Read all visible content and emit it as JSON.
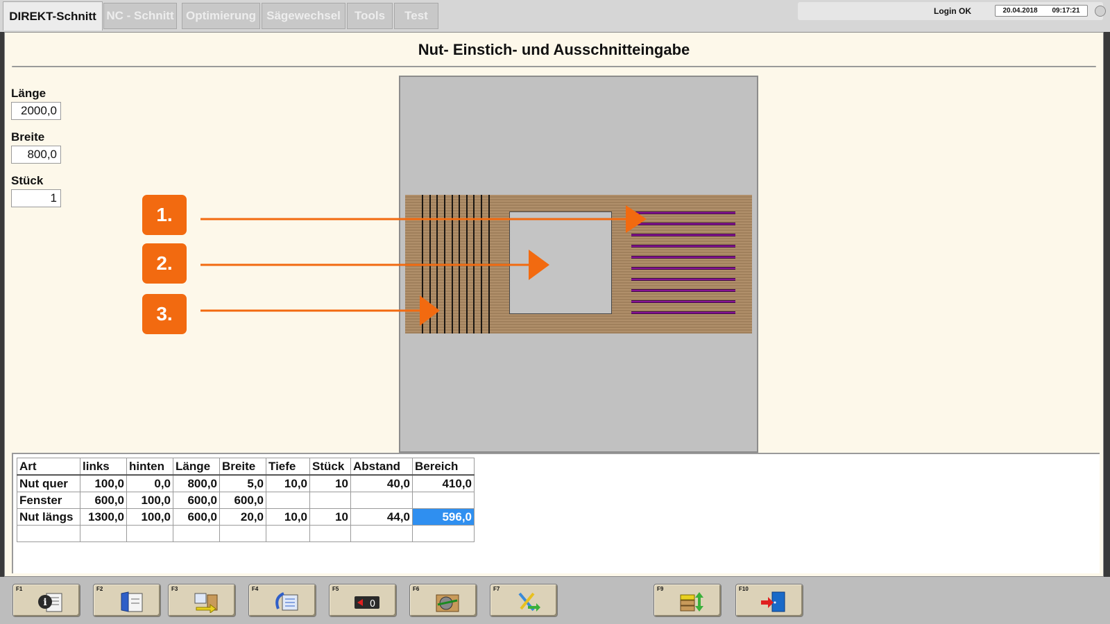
{
  "tabs": [
    {
      "label": "DIREKT-Schnitt",
      "active": true
    },
    {
      "label": "NC - Schnitt",
      "active": false
    },
    {
      "label": "Optimierung",
      "active": false
    },
    {
      "label": "Sägewechsel",
      "active": false
    },
    {
      "label": "Tools",
      "active": false
    },
    {
      "label": "Test",
      "active": false
    }
  ],
  "status": {
    "login": "Login OK",
    "date": "20.04.2018",
    "time": "09:17:21"
  },
  "title": "Nut- Einstich- und Ausschnitteingabe",
  "fields": {
    "laenge": {
      "label": "Länge",
      "value": "2000,0"
    },
    "breite": {
      "label": "Breite",
      "value": "800,0"
    },
    "stueck": {
      "label": "Stück",
      "value": "1"
    }
  },
  "callouts": [
    "1.",
    "2.",
    "3."
  ],
  "table": {
    "headers": [
      "Art",
      "links",
      "hinten",
      "Länge",
      "Breite",
      "Tiefe",
      "Stück",
      "Abstand",
      "Bereich"
    ],
    "rows": [
      [
        "Nut quer",
        "100,0",
        "0,0",
        "800,0",
        "5,0",
        "10,0",
        "10",
        "40,0",
        "410,0"
      ],
      [
        "Fenster",
        "600,0",
        "100,0",
        "600,0",
        "600,0",
        "",
        "",
        "",
        ""
      ],
      [
        "Nut längs",
        "1300,0",
        "100,0",
        "600,0",
        "20,0",
        "10,0",
        "10",
        "44,0",
        "596,0"
      ],
      [
        "",
        "",
        "",
        "",
        "",
        "",
        "",
        "",
        ""
      ]
    ],
    "selected_cell": "596,0"
  },
  "function_keys": [
    {
      "key": "F1",
      "icon": "info-icon"
    },
    {
      "key": "F2",
      "icon": "file-open-icon"
    },
    {
      "key": "F3",
      "icon": "list-transfer-icon"
    },
    {
      "key": "F4",
      "icon": "undo-list-icon"
    },
    {
      "key": "F5",
      "icon": "counter-reset-icon"
    },
    {
      "key": "F6",
      "icon": "saw-board-icon"
    },
    {
      "key": "F7",
      "icon": "tools-icon"
    },
    {
      "key": "F9",
      "icon": "stack-updown-icon"
    },
    {
      "key": "F10",
      "icon": "exit-door-icon"
    }
  ],
  "colors": {
    "accent_orange": "#f26a10",
    "selection_blue": "#2f8ff0",
    "groove_purple": "#8a1496"
  }
}
